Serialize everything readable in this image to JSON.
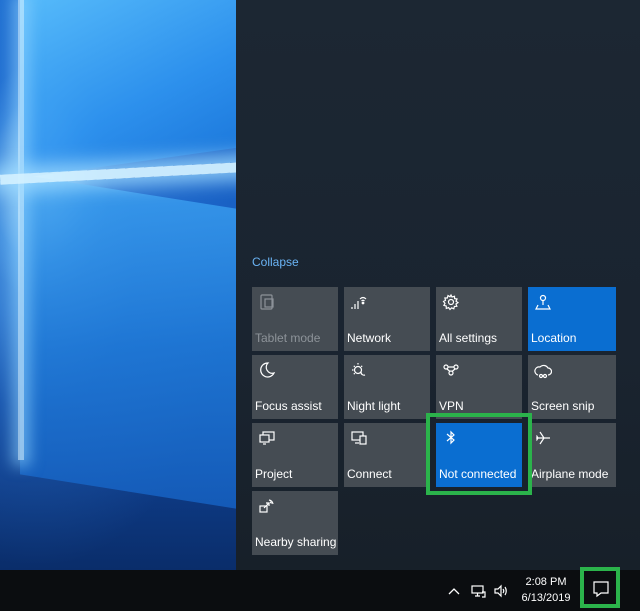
{
  "action_center": {
    "collapse_label": "Collapse",
    "tiles": [
      {
        "label": "Tablet mode",
        "icon": "tablet-mode-icon",
        "state": "disabled"
      },
      {
        "label": "Network",
        "icon": "network-icon",
        "state": "off"
      },
      {
        "label": "All settings",
        "icon": "gear-icon",
        "state": "off"
      },
      {
        "label": "Location",
        "icon": "location-icon",
        "state": "on"
      },
      {
        "label": "Focus assist",
        "icon": "moon-icon",
        "state": "off"
      },
      {
        "label": "Night light",
        "icon": "night-light-icon",
        "state": "off"
      },
      {
        "label": "VPN",
        "icon": "vpn-icon",
        "state": "off"
      },
      {
        "label": "Screen snip",
        "icon": "screen-snip-icon",
        "state": "off"
      },
      {
        "label": "Project",
        "icon": "project-icon",
        "state": "off"
      },
      {
        "label": "Connect",
        "icon": "connect-icon",
        "state": "off"
      },
      {
        "label": "Not connected",
        "icon": "bluetooth-icon",
        "state": "on"
      },
      {
        "label": "Airplane mode",
        "icon": "airplane-icon",
        "state": "off"
      },
      {
        "label": "Nearby sharing",
        "icon": "nearby-sharing-icon",
        "state": "off"
      }
    ]
  },
  "taskbar": {
    "time": "2:08 PM",
    "date": "6/13/2019",
    "tray_icons": [
      "chevron-up-icon",
      "network-icon",
      "volume-icon"
    ],
    "notification_icon": "action-center-icon"
  },
  "colors": {
    "accent": "#0a6ed1",
    "tile": "#454c53",
    "highlight": "#2bb34b",
    "link": "#6ab4f5"
  }
}
